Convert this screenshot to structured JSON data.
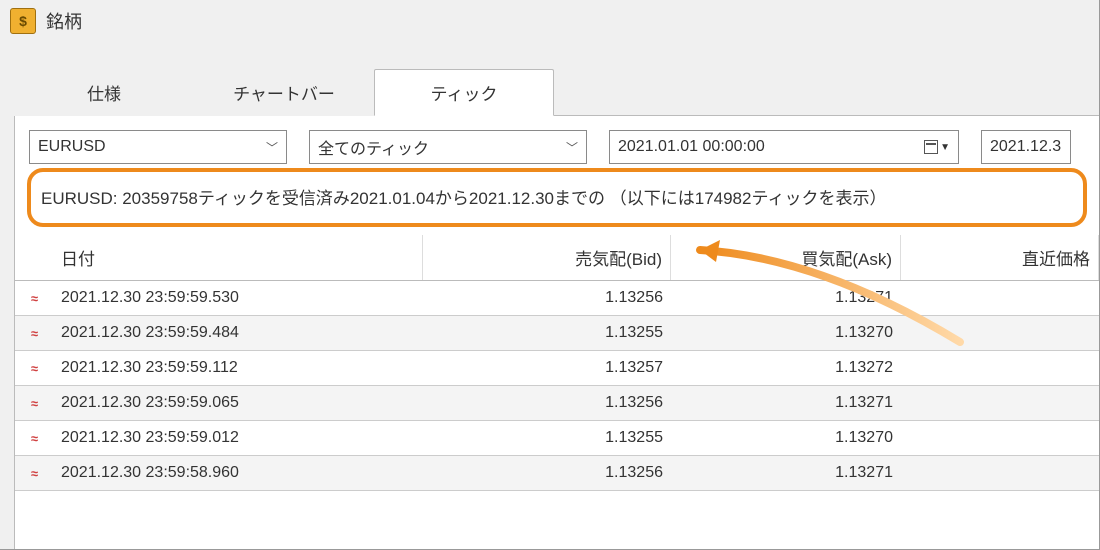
{
  "title": "銘柄",
  "tabs": [
    {
      "label": "仕様",
      "active": false
    },
    {
      "label": "チャートバー",
      "active": false
    },
    {
      "label": "ティック",
      "active": true
    }
  ],
  "filters": {
    "symbol": "EURUSD",
    "tick_type": "全てのティック",
    "date_from": "2021.01.01 00:00:00",
    "date_to": "2021.12.3"
  },
  "status": "EURUSD: 20359758ティックを受信済み2021.01.04から2021.12.30までの （以下には174982ティックを表示）",
  "columns": {
    "date": "日付",
    "bid": "売気配(Bid)",
    "ask": "買気配(Ask)",
    "last": "直近価格"
  },
  "rows": [
    {
      "date": "2021.12.30 23:59:59.530",
      "bid": "1.13256",
      "ask": "1.13271"
    },
    {
      "date": "2021.12.30 23:59:59.484",
      "bid": "1.13255",
      "ask": "1.13270"
    },
    {
      "date": "2021.12.30 23:59:59.112",
      "bid": "1.13257",
      "ask": "1.13272"
    },
    {
      "date": "2021.12.30 23:59:59.065",
      "bid": "1.13256",
      "ask": "1.13271"
    },
    {
      "date": "2021.12.30 23:59:59.012",
      "bid": "1.13255",
      "ask": "1.13270"
    },
    {
      "date": "2021.12.30 23:59:58.960",
      "bid": "1.13256",
      "ask": "1.13271"
    }
  ]
}
